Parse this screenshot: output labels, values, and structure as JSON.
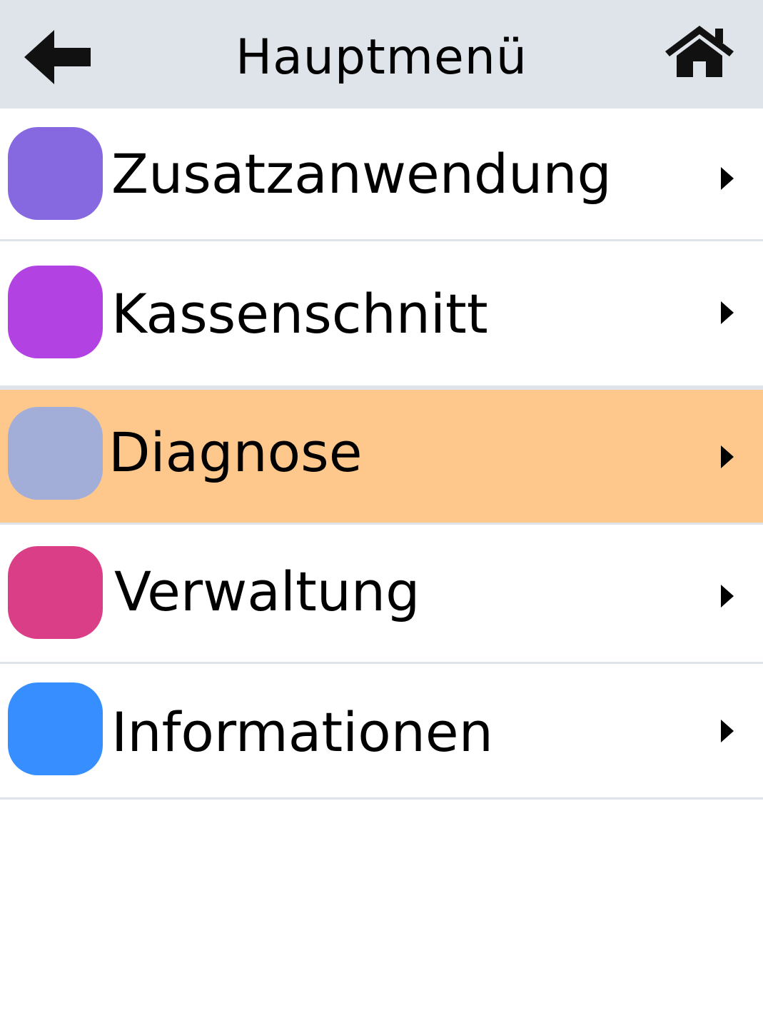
{
  "header": {
    "title": "Hauptmenü",
    "back_icon": "arrow-left-icon",
    "home_icon": "home-icon"
  },
  "menu": {
    "items": [
      {
        "label": "Zusatzanwendung",
        "color": "#8668e0",
        "selected": false
      },
      {
        "label": "Kassenschnitt",
        "color": "#b342e3",
        "selected": false
      },
      {
        "label": "Diagnose",
        "color": "#a3aed8",
        "selected": true
      },
      {
        "label": "Verwaltung",
        "color": "#da3e87",
        "selected": false
      },
      {
        "label": "Informationen",
        "color": "#378eff",
        "selected": false
      }
    ],
    "chevron_icon": "chevron-right-icon",
    "selected_background": "#fec88c"
  },
  "colors": {
    "header_background": "#dfe3ea",
    "divider": "#dfe3ea"
  }
}
